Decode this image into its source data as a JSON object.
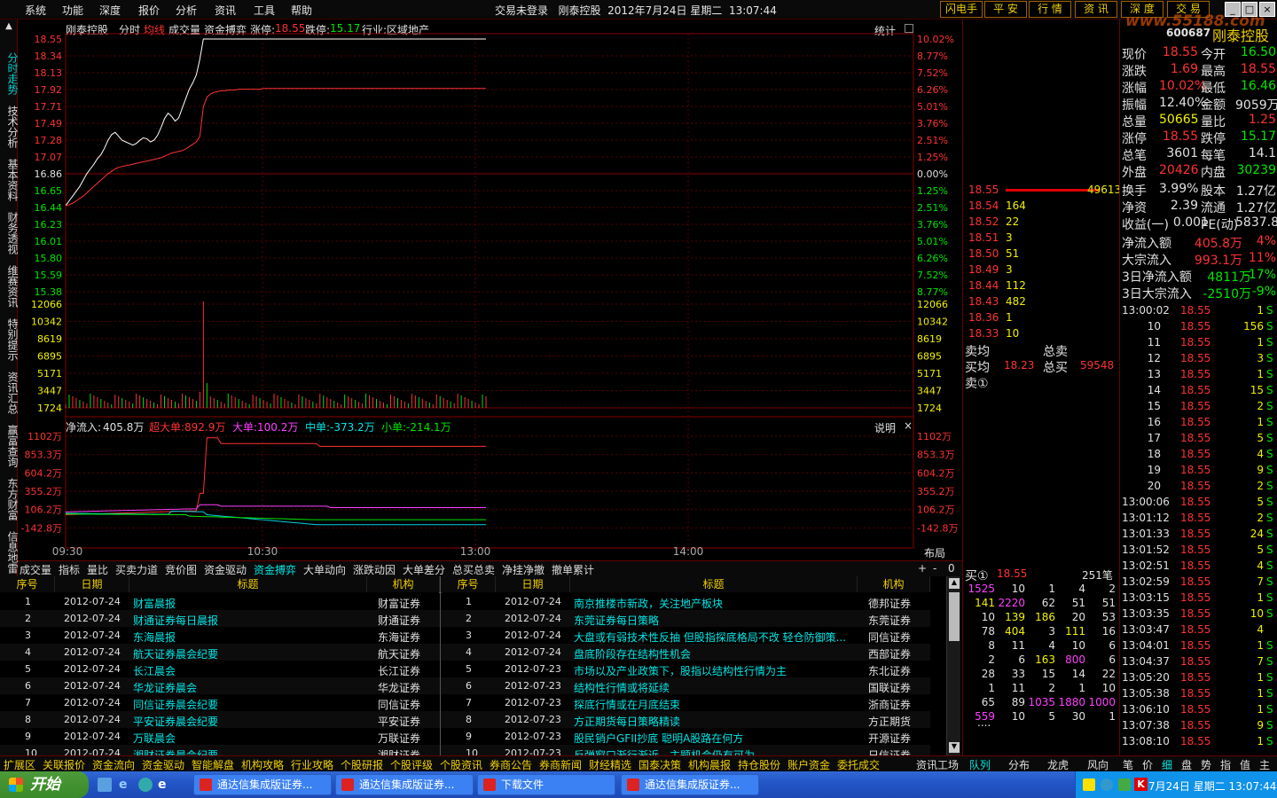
{
  "menu": [
    "系统",
    "功能",
    "深度",
    "报价",
    "分析",
    "资讯",
    "工具",
    "帮助"
  ],
  "title_bar": "交易未登录   刚泰控股  2012年7月24日 星期二  13:07:44",
  "right_buttons": [
    "闪电手",
    "平 安",
    "行 情",
    "资 讯",
    "深 度",
    "交 易"
  ],
  "window_controls": [
    "_",
    "□",
    "×"
  ],
  "watermark": "www.55188.com",
  "left_tabs": [
    "分时走势",
    "技术分析",
    "基本资料",
    "财务透视",
    "维赛资讯",
    "特别提示",
    "资讯汇总",
    "赢富查询",
    "东方财富",
    "信息地雷"
  ],
  "chart": {
    "header": {
      "name": "刚泰控股",
      "period": "分时",
      "avg_label": "均线",
      "vol_label": "成交量",
      "fund_label": "资金搏弈",
      "zt_label": "涨停:",
      "zt_value": "18.55",
      "dt_label": "跌停:",
      "dt_value": "15.17",
      "industry": "行业:区域地产"
    },
    "stat_label": "统计",
    "price_axis": [
      "18.55",
      "18.34",
      "18.13",
      "17.92",
      "17.71",
      "17.49",
      "17.28",
      "17.07",
      "16.86",
      "16.65",
      "16.44",
      "16.23",
      "16.01",
      "15.80",
      "15.59",
      "15.38"
    ],
    "pct_axis": [
      "10.02%",
      "8.77%",
      "7.52%",
      "6.26%",
      "5.01%",
      "3.76%",
      "2.51%",
      "1.25%",
      "0.00%",
      "1.25%",
      "2.51%",
      "3.76%",
      "5.01%",
      "6.26%",
      "7.52%",
      "8.77%"
    ],
    "vol_axis": [
      "12066",
      "10342",
      "8619",
      "6895",
      "5171",
      "3447",
      "1724"
    ],
    "price_series": [
      16.46,
      16.52,
      16.58,
      16.64,
      16.7,
      16.78,
      16.86,
      16.92,
      16.98,
      17.05,
      17.1,
      17.18,
      17.28,
      17.35,
      17.38,
      17.33,
      17.28,
      17.26,
      17.24,
      17.22,
      17.24,
      17.28,
      17.31,
      17.3,
      17.26,
      17.28,
      17.34,
      17.44,
      17.55,
      17.62,
      17.58,
      17.52,
      17.56,
      17.68,
      17.8,
      17.92,
      18.0,
      18.1,
      18.3,
      18.55,
      18.55,
      18.55,
      18.55,
      18.55,
      18.55,
      18.55,
      18.55,
      18.55,
      18.55,
      18.55,
      18.55,
      18.55,
      18.55,
      18.55,
      18.55,
      18.55,
      18.55,
      18.55,
      18.55,
      18.55,
      18.55,
      18.55,
      18.55,
      18.55,
      18.55,
      18.55,
      18.55,
      18.55,
      18.55,
      18.55,
      18.55,
      18.55,
      18.55,
      18.55,
      18.55,
      18.55,
      18.55,
      18.55,
      18.55,
      18.55,
      18.55,
      18.55,
      18.55,
      18.55,
      18.55,
      18.55,
      18.55,
      18.55,
      18.55,
      18.55,
      18.55,
      18.55,
      18.55,
      18.55,
      18.55,
      18.55,
      18.55,
      18.55,
      18.55,
      18.55,
      18.55,
      18.55,
      18.55,
      18.55,
      18.55,
      18.55,
      18.55,
      18.55,
      18.55,
      18.55,
      18.55,
      18.55,
      18.55,
      18.55,
      18.55,
      18.55,
      18.55,
      18.55,
      18.55,
      18.55
    ],
    "avg_series": [
      16.46,
      16.47,
      16.49,
      16.52,
      16.55,
      16.58,
      16.62,
      16.66,
      16.7,
      16.74,
      16.78,
      16.82,
      16.86,
      16.89,
      16.92,
      16.94,
      16.95,
      16.96,
      16.97,
      16.98,
      16.99,
      17.0,
      17.01,
      17.02,
      17.03,
      17.04,
      17.05,
      17.06,
      17.08,
      17.1,
      17.12,
      17.13,
      17.14,
      17.15,
      17.17,
      17.2,
      17.23,
      17.26,
      17.33,
      17.7,
      17.82,
      17.86,
      17.88,
      17.89,
      17.9,
      17.9,
      17.91,
      17.91,
      17.91,
      17.92,
      17.92,
      17.92,
      17.92,
      17.92,
      17.92,
      17.92,
      17.93,
      17.93,
      17.93,
      17.93,
      17.93,
      17.93,
      17.93,
      17.93,
      17.93,
      17.93,
      17.93,
      17.93,
      17.93,
      17.93,
      17.93,
      17.93,
      17.93,
      17.93,
      17.93,
      17.93,
      17.93,
      17.93,
      17.93,
      17.93,
      17.93,
      17.93,
      17.93,
      17.93,
      17.93,
      17.93,
      17.93,
      17.93,
      17.93,
      17.93,
      17.93,
      17.93,
      17.93,
      17.93,
      17.93,
      17.93,
      17.93,
      17.93,
      17.93,
      17.93,
      17.93,
      17.93,
      17.93,
      17.93,
      17.93,
      17.93,
      17.93,
      17.93,
      17.93,
      17.93,
      17.93,
      17.93,
      17.93,
      17.93,
      17.93,
      17.93,
      17.93,
      17.93,
      17.93,
      17.93
    ],
    "fund_header": {
      "net_label": "净流入:",
      "net_value": "405.8万",
      "xl_label": "超大单:",
      "xl_value": "892.9万",
      "l_label": "大单:",
      "l_value": "100.2万",
      "m_label": "中单:",
      "m_value": "-373.2万",
      "s_label": "小单:",
      "s_value": "-214.1万"
    },
    "explain_label": "说明",
    "fund_axis": [
      "1102万",
      "853.3万",
      "604.2万",
      "355.2万",
      "106.2万",
      "-142.8万"
    ],
    "time_axis": [
      "09:30",
      "10:30",
      "13:00",
      "14:00"
    ],
    "layout_label": "布局"
  },
  "sub_tabs": [
    "成交量",
    "指标",
    "量比",
    "买卖力道",
    "竞价图",
    "资金驱动",
    "资金搏弈",
    "大单动向",
    "涨跌动因",
    "大单差分",
    "总买总卖",
    "净挂净撤",
    "撤单累计"
  ],
  "sub_tabs_active": "资金搏弈",
  "news": {
    "headers": [
      "序号",
      "日期",
      "标题",
      "机构"
    ],
    "left": [
      {
        "no": "1",
        "date": "2012-07-24",
        "title": "财富晨报",
        "org": "财富证券"
      },
      {
        "no": "2",
        "date": "2012-07-24",
        "title": "财通证券每日晨报",
        "org": "财通证券"
      },
      {
        "no": "3",
        "date": "2012-07-24",
        "title": "东海晨报",
        "org": "东海证券"
      },
      {
        "no": "4",
        "date": "2012-07-24",
        "title": "航天证券晨会纪要",
        "org": "航天证券"
      },
      {
        "no": "5",
        "date": "2012-07-24",
        "title": "长江晨会",
        "org": "长江证券"
      },
      {
        "no": "6",
        "date": "2012-07-24",
        "title": "华龙证券晨会",
        "org": "华龙证券"
      },
      {
        "no": "7",
        "date": "2012-07-24",
        "title": "同信证券晨会纪要",
        "org": "同信证券"
      },
      {
        "no": "8",
        "date": "2012-07-24",
        "title": "平安证券晨会纪要",
        "org": "平安证券"
      },
      {
        "no": "9",
        "date": "2012-07-24",
        "title": "万联晨会",
        "org": "万联证券"
      },
      {
        "no": "10",
        "date": "2012-07-24",
        "title": "湘财证券晨会纪要",
        "org": "湘财证券"
      }
    ],
    "right": [
      {
        "no": "1",
        "date": "2012-07-24",
        "title": "南京推楼市新政，关注地产板块",
        "org": "德邦证券"
      },
      {
        "no": "2",
        "date": "2012-07-24",
        "title": "东莞证券每日策略",
        "org": "东莞证券"
      },
      {
        "no": "3",
        "date": "2012-07-24",
        "title": "大盘或有弱技术性反抽 但股指探底格局不改 轻仓防御策...",
        "org": "同信证券"
      },
      {
        "no": "4",
        "date": "2012-07-24",
        "title": "盘底阶段存在结构性机会",
        "org": "西部证券"
      },
      {
        "no": "5",
        "date": "2012-07-23",
        "title": "市场以及产业政策下，股指以结构性行情为主",
        "org": "东北证券"
      },
      {
        "no": "6",
        "date": "2012-07-23",
        "title": "结构性行情或将延续",
        "org": "国联证券"
      },
      {
        "no": "7",
        "date": "2012-07-23",
        "title": "探底行情或在月底结束",
        "org": "浙商证券"
      },
      {
        "no": "8",
        "date": "2012-07-23",
        "title": "方正期货每日策略精读",
        "org": "方正期货"
      },
      {
        "no": "9",
        "date": "2012-07-23",
        "title": "股民销户GFII抄底 聪明A股路在何方",
        "org": "开源证券"
      },
      {
        "no": "10",
        "date": "2012-07-23",
        "title": "反弹窗口渐行渐近，主题机会仍有可为",
        "org": "日信证券"
      }
    ]
  },
  "bottom_bar": [
    "扩展区",
    "关联报价",
    "资金流向",
    "资金驱动",
    "智能解盘",
    "机构攻略",
    "行业攻略",
    "个股研报",
    "个股评级",
    "个股资讯",
    "券商公告",
    "券商新闻",
    "财经精选",
    "国泰决策",
    "机构晨报",
    "持仓股份",
    "账户资金",
    "委托成交"
  ],
  "bottom_right": [
    "资讯工场",
    "队列",
    "分布",
    "龙虎",
    "风向",
    "笔",
    "价",
    "细",
    "盘",
    "势",
    "指",
    "值",
    "主"
  ],
  "orderbook": {
    "top_price": "18.55",
    "top_vol": "49613",
    "levels": [
      {
        "price": "18.54",
        "vol": "164"
      },
      {
        "price": "18.52",
        "vol": "22"
      },
      {
        "price": "18.51",
        "vol": "3"
      },
      {
        "price": "18.50",
        "vol": "51"
      },
      {
        "price": "18.49",
        "vol": "3"
      },
      {
        "price": "18.44",
        "vol": "112"
      },
      {
        "price": "18.43",
        "vol": "482"
      },
      {
        "price": "18.36",
        "vol": "1"
      },
      {
        "price": "18.33",
        "vol": "10"
      }
    ],
    "sell_avg_label": "卖均",
    "total_sell_label": "总卖",
    "buy_avg_label": "买均",
    "buy_avg": "18.23",
    "total_buy_label": "总买",
    "total_buy": "59548",
    "sell1_label": "卖①",
    "buy1_label": "买①",
    "buy1_price": "18.55",
    "buy1_count": "251笔",
    "queue": [
      [
        "1525",
        "10",
        "1",
        "4",
        "2"
      ],
      [
        "141",
        "2220",
        "62",
        "51",
        "51"
      ],
      [
        "10",
        "139",
        "186",
        "20",
        "53"
      ],
      [
        "78",
        "404",
        "3",
        "111",
        "16"
      ],
      [
        "8",
        "11",
        "4",
        "10",
        "6"
      ],
      [
        "2",
        "6",
        "163",
        "800",
        "6"
      ],
      [
        "28",
        "33",
        "15",
        "14",
        "22"
      ],
      [
        "1",
        "11",
        "2",
        "1",
        "10"
      ],
      [
        "65",
        "89",
        "1035",
        "1880",
        "1000"
      ],
      [
        "559",
        "10",
        "5",
        "30",
        "1"
      ]
    ],
    "ellipsis": "....",
    "queue_colors": {
      "hi": "#ff40ff",
      "mid": "#f0f000",
      "norm": "#e0e0e0"
    }
  },
  "quote": {
    "code": "600687",
    "name": "刚泰控股",
    "rows": [
      [
        {
          "l": "现价",
          "v": "18.55",
          "c": "red"
        },
        {
          "l": "今开",
          "v": "16.50",
          "c": "green"
        }
      ],
      [
        {
          "l": "涨跌",
          "v": "1.69",
          "c": "red"
        },
        {
          "l": "最高",
          "v": "18.55",
          "c": "red"
        }
      ],
      [
        {
          "l": "涨幅",
          "v": "10.02%",
          "c": "red"
        },
        {
          "l": "最低",
          "v": "16.46",
          "c": "green"
        }
      ],
      [
        {
          "l": "振幅",
          "v": "12.40%",
          "c": "white"
        },
        {
          "l": "金额",
          "v": "9059万",
          "c": "white"
        }
      ],
      [
        {
          "l": "总量",
          "v": "50665",
          "c": "yellow"
        },
        {
          "l": "量比",
          "v": "1.25",
          "c": "red"
        }
      ],
      [
        {
          "l": "涨停",
          "v": "18.55",
          "c": "red"
        },
        {
          "l": "跌停",
          "v": "15.17",
          "c": "green"
        }
      ],
      [
        {
          "l": "总笔",
          "v": "3601",
          "c": "white"
        },
        {
          "l": "每笔",
          "v": "14.1",
          "c": "white"
        }
      ],
      [
        {
          "l": "外盘",
          "v": "20426",
          "c": "red"
        },
        {
          "l": "内盘",
          "v": "30239",
          "c": "green"
        }
      ],
      [
        {
          "l": "换手",
          "v": "3.99%",
          "c": "white"
        },
        {
          "l": "股本",
          "v": "1.27亿",
          "c": "white"
        }
      ],
      [
        {
          "l": "净资",
          "v": "2.39",
          "c": "white"
        },
        {
          "l": "流通",
          "v": "1.27亿",
          "c": "white"
        }
      ],
      [
        {
          "l": "收益(一)",
          "v": "0.001",
          "c": "white"
        },
        {
          "l": "PE(动)",
          "v": "5837.8",
          "c": "white"
        }
      ]
    ],
    "flow": [
      {
        "l": "净流入额",
        "v": "405.8万",
        "p": "4%",
        "c": "red"
      },
      {
        "l": "大宗流入",
        "v": "993.1万",
        "p": "11%",
        "c": "red"
      },
      {
        "l": "3日净流入额",
        "v": "4811万",
        "p": "-17%",
        "c": "green"
      },
      {
        "l": "3日大宗流入",
        "v": "-2510万",
        "p": "-9%",
        "c": "green"
      }
    ],
    "ticks": [
      {
        "t": "13:00:02",
        "p": "18.55",
        "v": "1",
        "f": "S"
      },
      {
        "t": "10",
        "p": "18.55",
        "v": "156",
        "f": "S"
      },
      {
        "t": "11",
        "p": "18.55",
        "v": "1",
        "f": "S"
      },
      {
        "t": "12",
        "p": "18.55",
        "v": "3",
        "f": "S"
      },
      {
        "t": "13",
        "p": "18.55",
        "v": "1",
        "f": "S"
      },
      {
        "t": "14",
        "p": "18.55",
        "v": "15",
        "f": "S"
      },
      {
        "t": "15",
        "p": "18.55",
        "v": "2",
        "f": "S"
      },
      {
        "t": "16",
        "p": "18.55",
        "v": "1",
        "f": "S"
      },
      {
        "t": "17",
        "p": "18.55",
        "v": "5",
        "f": "S"
      },
      {
        "t": "18",
        "p": "18.55",
        "v": "4",
        "f": "S"
      },
      {
        "t": "19",
        "p": "18.55",
        "v": "9",
        "f": "S"
      },
      {
        "t": "20",
        "p": "18.55",
        "v": "2",
        "f": "S"
      },
      {
        "t": "13:00:06",
        "p": "18.55",
        "v": "5",
        "f": "S"
      },
      {
        "t": "13:01:12",
        "p": "18.55",
        "v": "2",
        "f": "S"
      },
      {
        "t": "13:01:33",
        "p": "18.55",
        "v": "24",
        "f": "S"
      },
      {
        "t": "13:01:52",
        "p": "18.55",
        "v": "5",
        "f": "S"
      },
      {
        "t": "13:02:51",
        "p": "18.55",
        "v": "4",
        "f": "S"
      },
      {
        "t": "13:02:59",
        "p": "18.55",
        "v": "7",
        "f": "S"
      },
      {
        "t": "13:03:15",
        "p": "18.55",
        "v": "1",
        "f": "S"
      },
      {
        "t": "13:03:35",
        "p": "18.55",
        "v": "10",
        "f": "S"
      },
      {
        "t": "13:03:47",
        "p": "18.55",
        "v": "4",
        "f": ""
      },
      {
        "t": "13:04:01",
        "p": "18.55",
        "v": "1",
        "f": "S"
      },
      {
        "t": "13:04:37",
        "p": "18.55",
        "v": "7",
        "f": "S"
      },
      {
        "t": "13:05:20",
        "p": "18.55",
        "v": "1",
        "f": "S"
      },
      {
        "t": "13:05:38",
        "p": "18.55",
        "v": "1",
        "f": "S"
      },
      {
        "t": "13:06:10",
        "p": "18.55",
        "v": "1",
        "f": "S"
      },
      {
        "t": "13:07:38",
        "p": "18.55",
        "v": "9",
        "f": "S"
      },
      {
        "t": "13:08:10",
        "p": "18.55",
        "v": "1",
        "f": "S"
      }
    ]
  },
  "taskbar": {
    "start": "开始",
    "tasks": [
      "通达信集成版证券...",
      "通达信集成版证券...",
      "下载文件",
      "通达信集成版证券..."
    ],
    "clock": "7月24日 星期二 13:07:44"
  }
}
